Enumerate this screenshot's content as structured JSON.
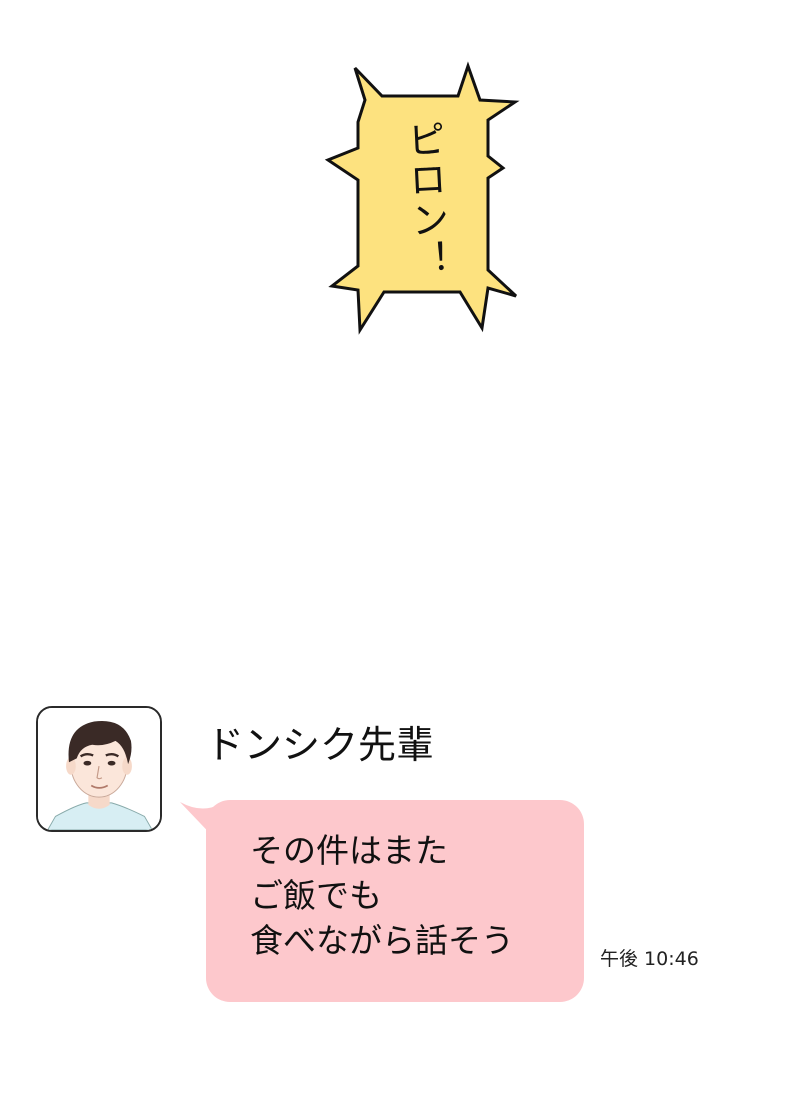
{
  "sfx": {
    "text": "ピロン！",
    "fill_color": "#fde27f",
    "outline_color": "#111111"
  },
  "message": {
    "sender_name": "ドンシク先輩",
    "avatar_icon": "avatar-man-icon",
    "lines": [
      "その件はまた",
      "ご飯でも",
      "食べながら話そう"
    ],
    "bubble_color": "#fdc8cc",
    "timestamp": "午後 10:46"
  }
}
